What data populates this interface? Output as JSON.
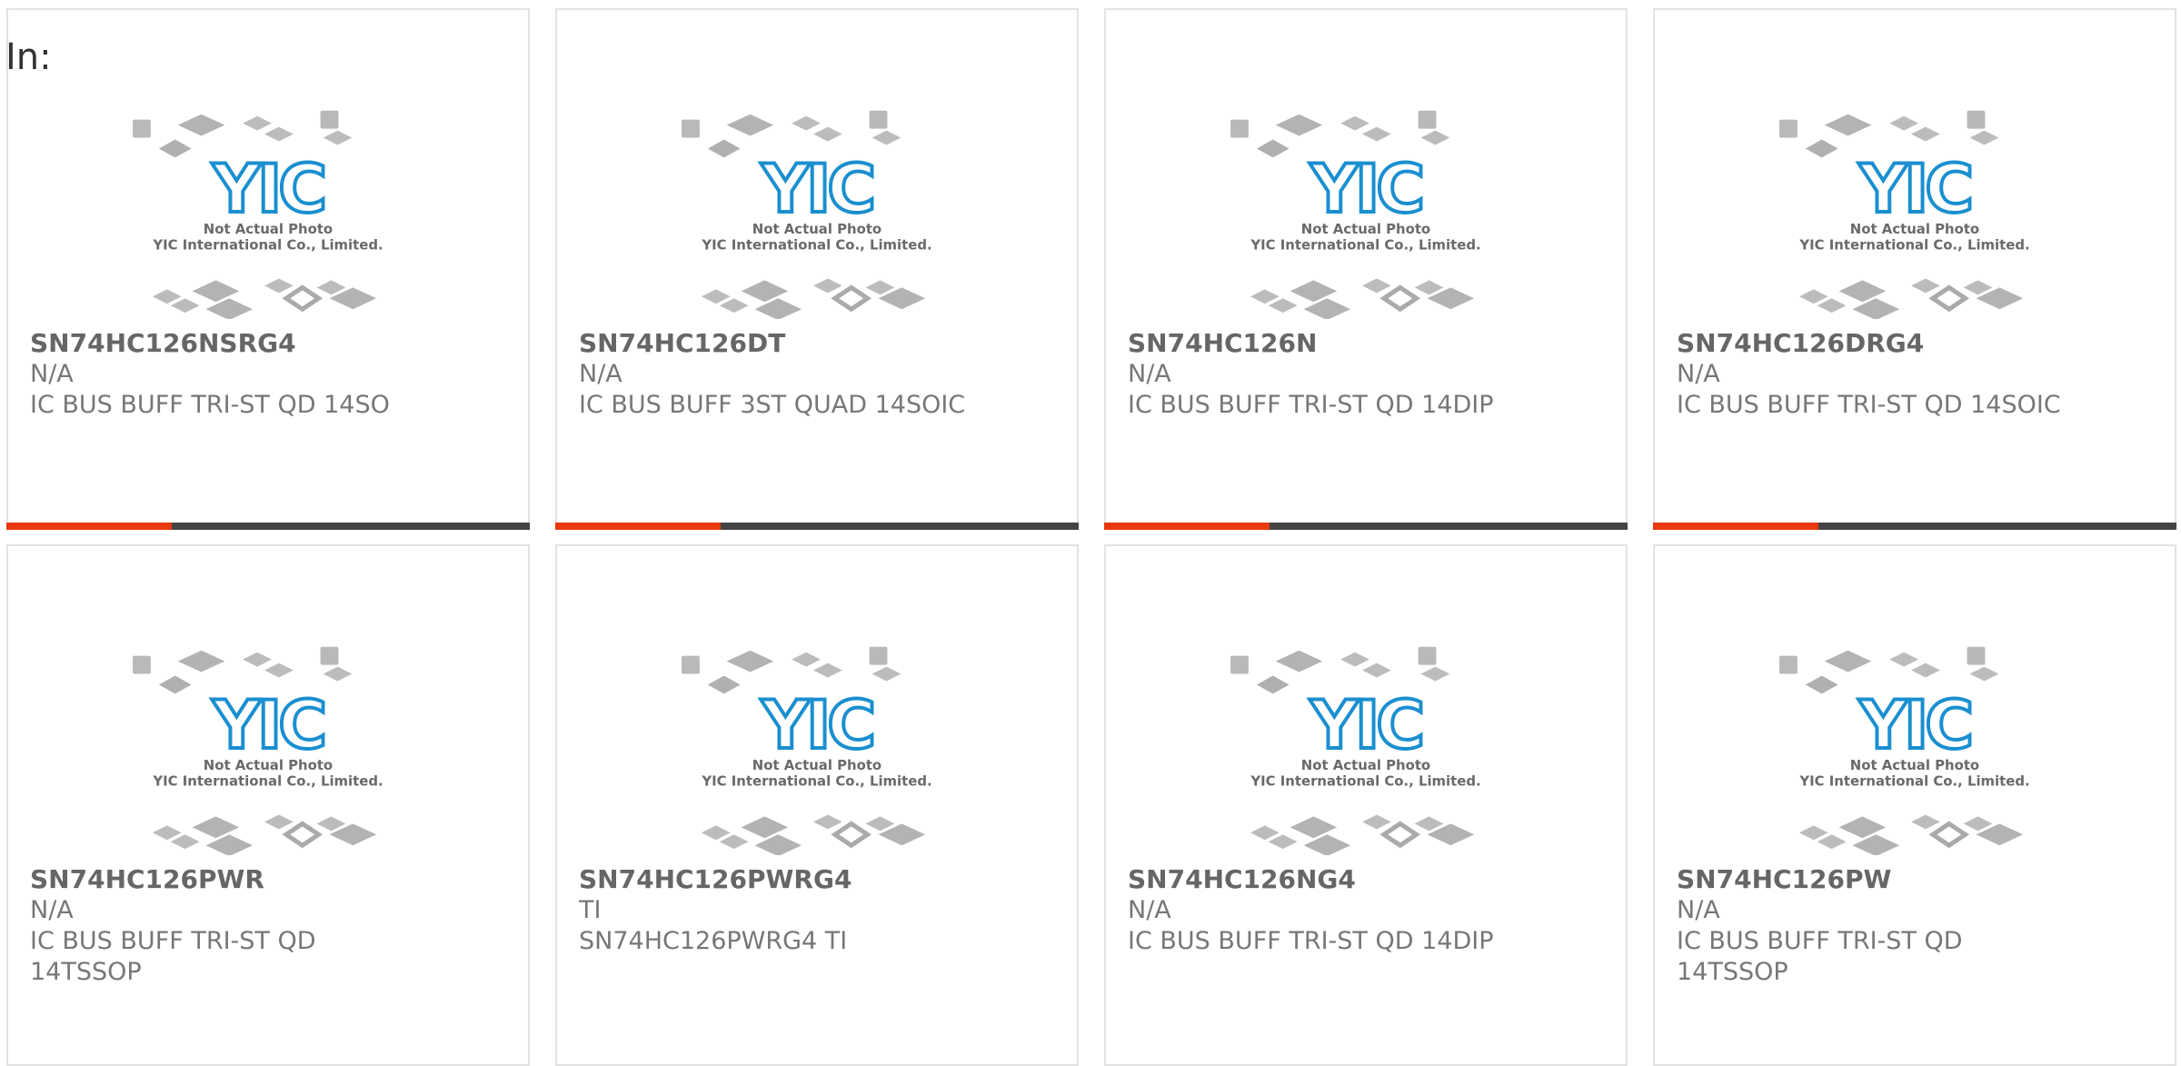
{
  "page": {
    "label": "In:"
  },
  "placeholder": {
    "line1": "Not Actual Photo",
    "line2": "YIC International Co., Limited.",
    "logo_text": "YIC"
  },
  "colors": {
    "accent": "#e8380d",
    "bar": "#444444",
    "logo": "#1a8fd0",
    "border": "#e3e3e3"
  },
  "products": [
    {
      "part": "SN74HC126NSRG4",
      "mfr": "N/A",
      "desc": "IC BUS BUFF TRI-ST QD 14SO"
    },
    {
      "part": "SN74HC126DT",
      "mfr": "N/A",
      "desc": "IC BUS BUFF 3ST QUAD 14SOIC"
    },
    {
      "part": "SN74HC126N",
      "mfr": "N/A",
      "desc": "IC BUS BUFF TRI-ST QD 14DIP"
    },
    {
      "part": "SN74HC126DRG4",
      "mfr": "N/A",
      "desc": "IC BUS BUFF TRI-ST QD 14SOIC"
    },
    {
      "part": "SN74HC126PWR",
      "mfr": "N/A",
      "desc": "IC BUS BUFF TRI-ST QD 14TSSOP"
    },
    {
      "part": "SN74HC126PWRG4",
      "mfr": "TI",
      "desc": "SN74HC126PWRG4 TI"
    },
    {
      "part": "SN74HC126NG4",
      "mfr": "N/A",
      "desc": "IC BUS BUFF TRI-ST QD 14DIP"
    },
    {
      "part": "SN74HC126PW",
      "mfr": "N/A",
      "desc": "IC BUS BUFF TRI-ST QD 14TSSOP"
    }
  ]
}
